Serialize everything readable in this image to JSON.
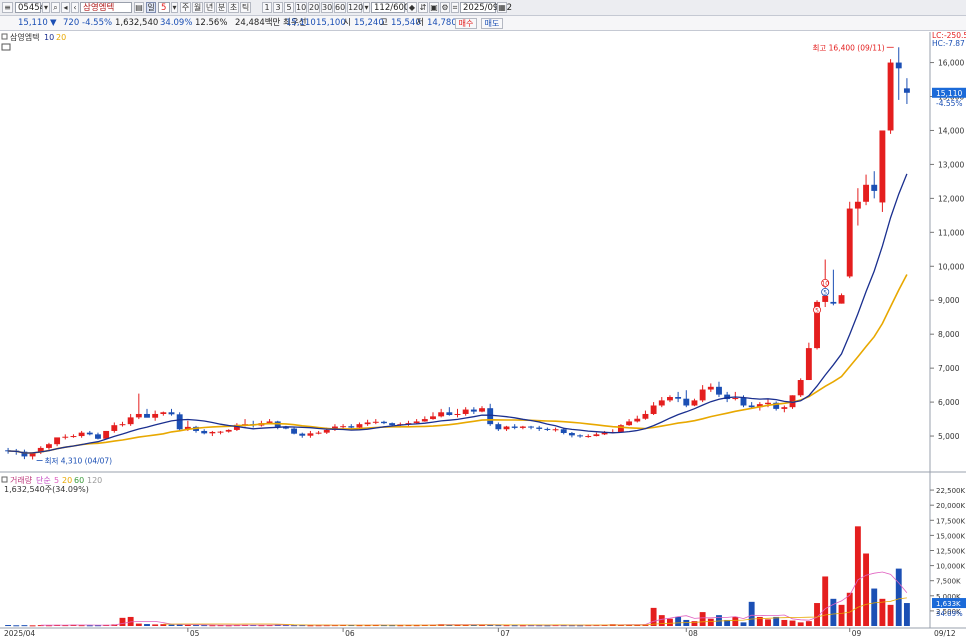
{
  "toolbar": {
    "code": "054540",
    "stock_name": "삼영엠텍",
    "period_value": "5",
    "period_buttons": [
      "주",
      "월",
      "년",
      "분",
      "초",
      "틱"
    ],
    "interval_buttons": [
      "1",
      "3",
      "5",
      "10",
      "20",
      "30",
      "60",
      "120"
    ],
    "count": "112",
    "count_max": "600",
    "date": "2025/09/12"
  },
  "quote": {
    "price": "15,110",
    "change": "720",
    "change_pct": "-4.55%",
    "volume": "1,632,540",
    "volume_ratio": "34.09%",
    "turnover": "12.56%",
    "amount": "24,484백만",
    "priority_label": "최우선",
    "ask": "15,110",
    "bid": "15,100",
    "open_label": "시",
    "open": "15,240",
    "high_label": "고",
    "high": "15,540",
    "low_label": "저",
    "low": "14,780",
    "buy_label": "매수",
    "sell_label": "매도"
  },
  "legend": {
    "price_name": "삼영엠텍",
    "ma_short": "10",
    "ma_long": "20",
    "volume_name": "거래량",
    "vol_ma_label": "단순",
    "vol_ma_periods": [
      "5",
      "20",
      "60",
      "120"
    ],
    "volume_readout": "1,632,540주(34.09%)"
  },
  "colors": {
    "up": "#e41e1e",
    "down": "#1b4fb4",
    "ma10": "#1a2f8f",
    "ma20": "#e8a800",
    "vol_ma5": "#e060c0",
    "vol_ma20": "#e8a800"
  },
  "chart_data": [
    {
      "type": "candlestick",
      "title": "",
      "x": [
        "04/01",
        "04/02",
        "04/03",
        "04/04",
        "04/07",
        "04/08",
        "04/09",
        "04/10",
        "04/11",
        "04/14",
        "04/15",
        "04/16",
        "04/17",
        "04/18",
        "04/21",
        "04/22",
        "04/23",
        "04/24",
        "04/25",
        "04/28",
        "04/29",
        "04/30",
        "05/02",
        "05/07",
        "05/08",
        "05/09",
        "05/12",
        "05/13",
        "05/14",
        "05/15",
        "05/16",
        "05/19",
        "05/20",
        "05/21",
        "05/22",
        "05/23",
        "05/26",
        "05/27",
        "05/28",
        "05/29",
        "05/30",
        "06/02",
        "06/04",
        "06/05",
        "06/09",
        "06/10",
        "06/11",
        "06/12",
        "06/13",
        "06/16",
        "06/17",
        "06/18",
        "06/19",
        "06/20",
        "06/23",
        "06/24",
        "06/25",
        "06/26",
        "06/27",
        "06/30",
        "07/01",
        "07/02",
        "07/03",
        "07/04",
        "07/07",
        "07/08",
        "07/09",
        "07/10",
        "07/11",
        "07/14",
        "07/15",
        "07/16",
        "07/17",
        "07/18",
        "07/21",
        "07/22",
        "07/23",
        "07/24",
        "07/25",
        "07/28",
        "07/29",
        "07/30",
        "07/31",
        "08/01",
        "08/04",
        "08/05",
        "08/06",
        "08/07",
        "08/08",
        "08/11",
        "08/12",
        "08/13",
        "08/14",
        "08/18",
        "08/19",
        "08/20",
        "08/21",
        "08/22",
        "08/25",
        "08/26",
        "08/27",
        "08/28",
        "08/29",
        "09/01",
        "09/02",
        "09/03",
        "09/04",
        "09/05",
        "09/08",
        "09/09",
        "09/10",
        "09/11",
        "09/12"
      ],
      "open": [
        4580,
        4570,
        4540,
        4400,
        4520,
        4650,
        4760,
        4960,
        4980,
        5000,
        5100,
        5050,
        4920,
        5150,
        5320,
        5350,
        5550,
        5650,
        5540,
        5650,
        5700,
        5640,
        5200,
        5270,
        5150,
        5080,
        5120,
        5130,
        5180,
        5330,
        5350,
        5310,
        5380,
        5430,
        5270,
        5220,
        5070,
        5010,
        5080,
        5100,
        5180,
        5280,
        5290,
        5250,
        5350,
        5400,
        5420,
        5380,
        5320,
        5350,
        5380,
        5430,
        5500,
        5580,
        5700,
        5620,
        5650,
        5780,
        5720,
        5820,
        5350,
        5200,
        5280,
        5240,
        5280,
        5250,
        5210,
        5180,
        5200,
        5090,
        5020,
        4990,
        5000,
        5050,
        5100,
        5120,
        5320,
        5430,
        5510,
        5650,
        5900,
        6050,
        6150,
        6100,
        5900,
        6050,
        6370,
        6450,
        6220,
        6090,
        6120,
        5900,
        5850,
        5940,
        5980,
        5800,
        5850,
        6200,
        6650,
        7590,
        8950,
        8950,
        8900,
        9700,
        11700,
        11900,
        12400,
        11880,
        14000,
        16000,
        15240
      ],
      "high": [
        4650,
        4620,
        4600,
        4520,
        4700,
        4800,
        4900,
        5050,
        5050,
        5150,
        5150,
        5100,
        5150,
        5400,
        5420,
        5650,
        6250,
        5800,
        5750,
        5720,
        5800,
        5700,
        5450,
        5300,
        5200,
        5150,
        5150,
        5200,
        5380,
        5500,
        5450,
        5450,
        5500,
        5450,
        5300,
        5250,
        5100,
        5150,
        5150,
        5250,
        5350,
        5350,
        5350,
        5400,
        5480,
        5500,
        5450,
        5400,
        5400,
        5450,
        5500,
        5580,
        5700,
        5800,
        5850,
        5800,
        5850,
        5850,
        5880,
        5950,
        5400,
        5300,
        5350,
        5300,
        5300,
        5300,
        5250,
        5250,
        5250,
        5120,
        5050,
        5050,
        5100,
        5150,
        5200,
        5350,
        5500,
        5600,
        5750,
        6000,
        6150,
        6200,
        6300,
        6350,
        6100,
        6500,
        6550,
        6600,
        6300,
        6300,
        6200,
        6000,
        6000,
        6080,
        6020,
        5900,
        6200,
        6700,
        7750,
        9000,
        10200,
        9900,
        9200,
        11900,
        12300,
        12700,
        12800,
        12200,
        16100,
        16450,
        15540
      ],
      "low": [
        4480,
        4450,
        4320,
        4310,
        4470,
        4600,
        4700,
        4900,
        4950,
        4950,
        5020,
        4900,
        4900,
        5100,
        5280,
        5300,
        5500,
        5580,
        5450,
        5600,
        5600,
        5150,
        5150,
        5100,
        5050,
        5000,
        5050,
        5100,
        5150,
        5280,
        5250,
        5280,
        5350,
        5200,
        5200,
        5050,
        4950,
        4950,
        5050,
        5060,
        5150,
        5200,
        5200,
        5200,
        5300,
        5350,
        5350,
        5300,
        5250,
        5300,
        5350,
        5420,
        5480,
        5550,
        5600,
        5550,
        5600,
        5650,
        5700,
        5300,
        5150,
        5150,
        5200,
        5200,
        5200,
        5150,
        5150,
        5130,
        5050,
        4960,
        4950,
        4950,
        4990,
        5030,
        5080,
        5100,
        5300,
        5400,
        5480,
        5620,
        5850,
        6000,
        6000,
        5850,
        5880,
        6000,
        6300,
        6150,
        6000,
        6050,
        5850,
        5800,
        5750,
        5850,
        5750,
        5700,
        5800,
        6150,
        6650,
        7550,
        8800,
        8850,
        8900,
        9650,
        11200,
        11800,
        12000,
        11600,
        13900,
        14900,
        14780
      ],
      "close": [
        4560,
        4540,
        4400,
        4520,
        4650,
        4760,
        4960,
        4980,
        5000,
        5100,
        5050,
        4920,
        5150,
        5320,
        5350,
        5550,
        5650,
        5540,
        5650,
        5700,
        5640,
        5200,
        5270,
        5150,
        5080,
        5120,
        5130,
        5180,
        5330,
        5350,
        5310,
        5380,
        5430,
        5270,
        5220,
        5070,
        5010,
        5080,
        5100,
        5180,
        5280,
        5290,
        5250,
        5350,
        5400,
        5420,
        5380,
        5320,
        5350,
        5380,
        5430,
        5500,
        5580,
        5700,
        5620,
        5650,
        5780,
        5720,
        5820,
        5350,
        5200,
        5280,
        5240,
        5280,
        5250,
        5210,
        5180,
        5200,
        5090,
        5020,
        4990,
        5000,
        5050,
        5100,
        5120,
        5320,
        5430,
        5510,
        5650,
        5900,
        6050,
        6150,
        6100,
        5900,
        6050,
        6370,
        6450,
        6220,
        6090,
        6120,
        5900,
        5850,
        5940,
        5980,
        5800,
        5850,
        6200,
        6650,
        7590,
        8950,
        9130,
        8900,
        9150,
        11700,
        11900,
        12400,
        12220,
        14000,
        16000,
        15830,
        15110
      ],
      "volume": [
        160,
        120,
        140,
        110,
        150,
        130,
        180,
        150,
        200,
        140,
        120,
        130,
        180,
        260,
        1350,
        1500,
        400,
        320,
        260,
        300,
        220,
        240,
        180,
        160,
        150,
        130,
        140,
        120,
        150,
        180,
        160,
        140,
        150,
        200,
        160,
        140,
        150,
        120,
        130,
        140,
        150,
        180,
        160,
        140,
        150,
        160,
        150,
        140,
        130,
        150,
        140,
        180,
        200,
        300,
        250,
        220,
        200,
        180,
        250,
        200,
        150,
        140,
        130,
        120,
        140,
        130,
        120,
        150,
        140,
        130,
        120,
        150,
        160,
        180,
        300,
        180,
        250,
        200,
        280,
        3000,
        1800,
        1200,
        1500,
        1000,
        800,
        2300,
        1200,
        1800,
        1000,
        1500,
        600,
        4000,
        1500,
        1100,
        1500,
        1000,
        900,
        600,
        800,
        3800,
        8200,
        4500,
        3500,
        5500,
        16500,
        12000,
        6200,
        4500,
        3500,
        9500,
        3800
      ],
      "ylim": [
        4000,
        16900
      ],
      "y_ticks": [
        "5,000",
        "6,000",
        "7,000",
        "8,000",
        "9,000",
        "10,000",
        "11,000",
        "12,000",
        "13,000",
        "14,000",
        "15,000",
        "16,000"
      ],
      "x_ticks": [
        "2025/04",
        "05",
        "06",
        "07",
        "08",
        "09",
        "09/12"
      ],
      "annotations": {
        "high_label": "최고 16,400 (09/11)",
        "low_label": "최저 4,310 (04/07)",
        "price_tag": "15,110",
        "price_tag_pct": "-4.55%",
        "top_right_1": "LC:-250.58",
        "top_right_2": "HC:-7.87",
        "ma_markers": [
          "5",
          "10"
        ]
      }
    },
    {
      "type": "bar",
      "title": "거래량",
      "y_ticks": [
        "2,500K",
        "5,000K",
        "7,500K",
        "10,000K",
        "12,500K",
        "15,000K",
        "17,500K",
        "20,000K",
        "22,500K"
      ],
      "ylim": [
        0,
        24500
      ],
      "annotations": {
        "vol_tag": "1,633K",
        "vol_pct": "34.09%"
      }
    }
  ]
}
